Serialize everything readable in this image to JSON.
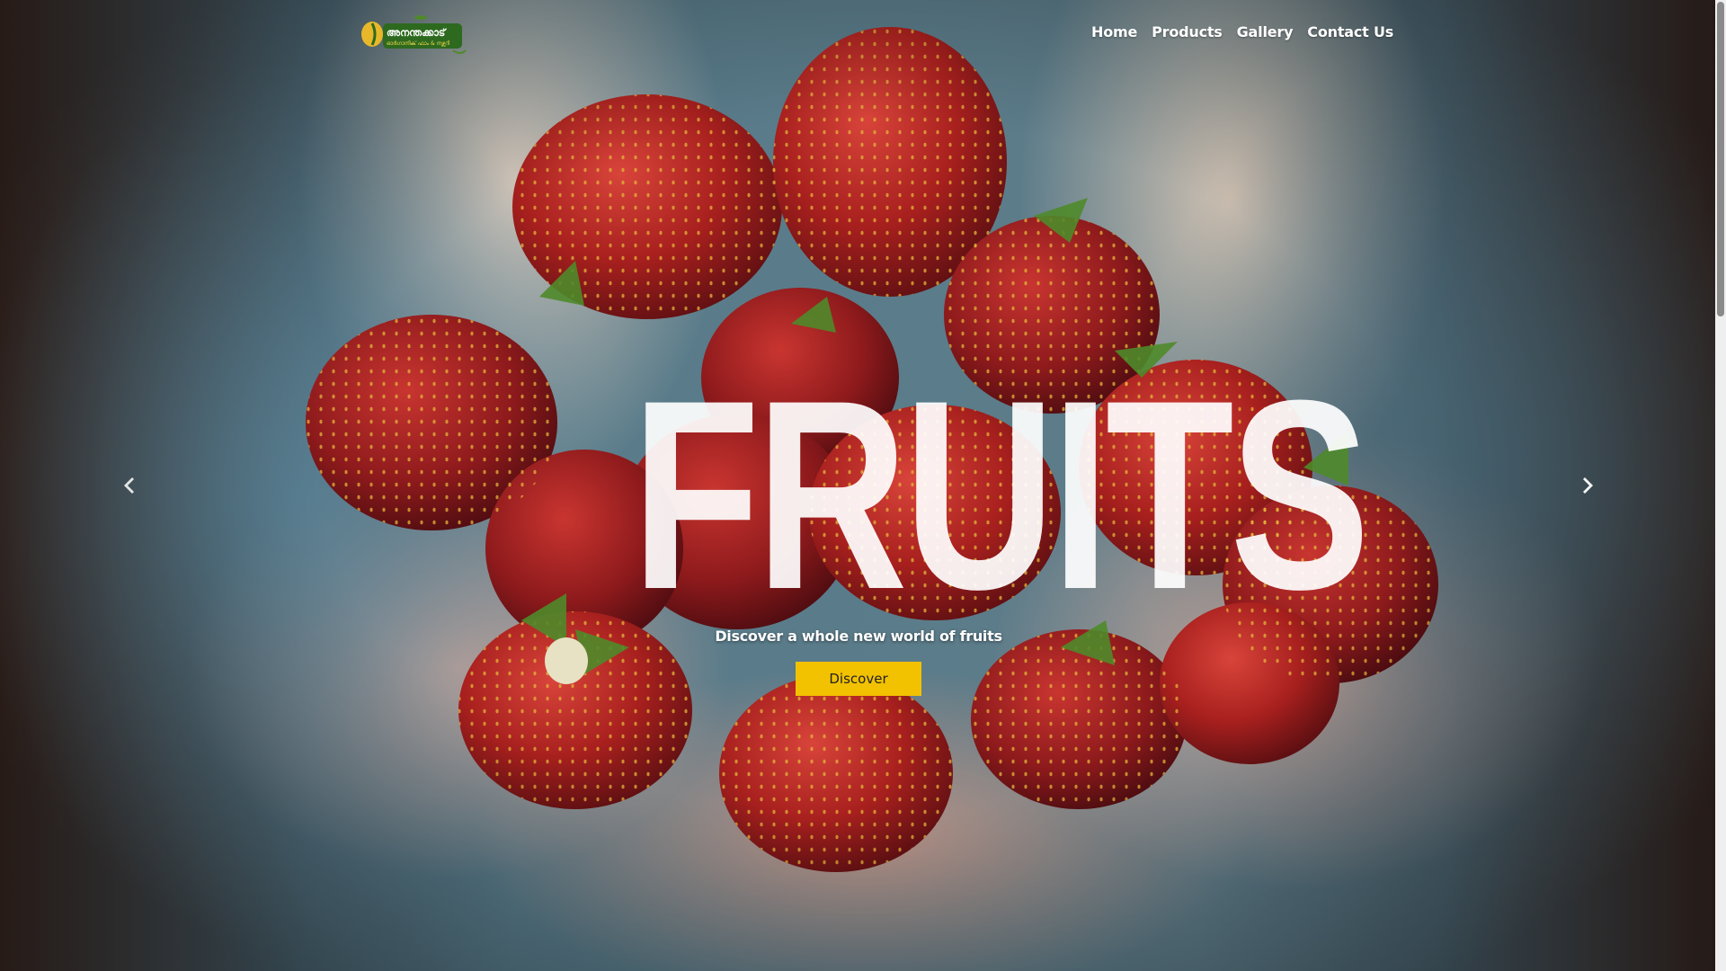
{
  "brand": {
    "logo_text": "അനന്തക്കാട്",
    "logo_subtext": "ഓർഗാനിക് ഫാം & നഴ്സറി"
  },
  "nav": {
    "items": [
      {
        "label": "Home"
      },
      {
        "label": "Products"
      },
      {
        "label": "Gallery"
      },
      {
        "label": "Contact Us"
      }
    ]
  },
  "hero": {
    "headline": "FRUITS",
    "tagline": "Discover a whole new world of fruits",
    "cta_label": "Discover"
  },
  "colors": {
    "cta_background": "#f2c100",
    "nav_text": "#ffffff",
    "logo_green": "#2d6a1f"
  },
  "icons": {
    "prev": "chevron-left-icon",
    "next": "chevron-right-icon"
  }
}
